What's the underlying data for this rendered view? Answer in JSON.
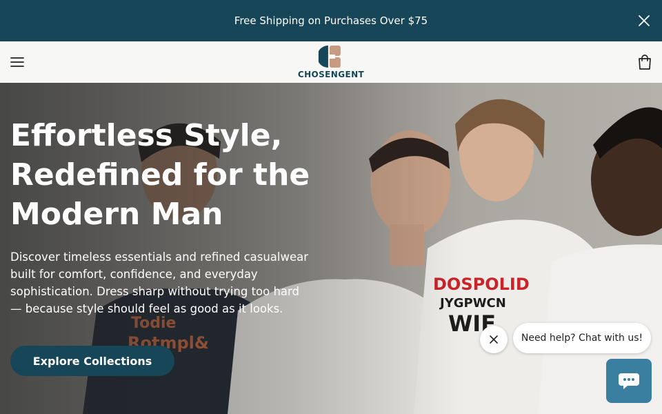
{
  "announcement": {
    "text": "Free Shipping on Purchases Over $75",
    "close_icon": "close-icon"
  },
  "header": {
    "menu_icon": "hamburger-menu-icon",
    "logo_text": "CHOSENGENT",
    "cart_icon": "shopping-bag-icon"
  },
  "hero": {
    "headline": "Effortless Style, Redefined for the Modern Man",
    "subtext": "Discover timeless essentials and refined casualwear built for comfort, confidence, and everyday sophistication. Dress sharp without trying too hard — because style should feel as good as it looks.",
    "cta_label": "Explore Collections"
  },
  "chat": {
    "prompt": "Need help? Chat with us!",
    "close_icon": "close-icon",
    "launcher_icon": "chat-bubble-icon"
  },
  "colors": {
    "brand": "#164658",
    "accent_tan": "#c99a82",
    "chat_launcher": "#3a7fa0"
  }
}
